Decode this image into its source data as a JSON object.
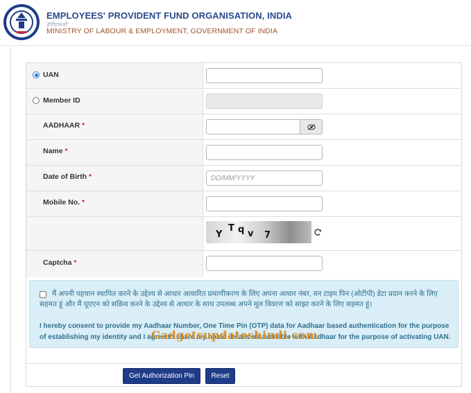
{
  "header": {
    "org_name": "EMPLOYEES' PROVIDENT FUND ORGANISATION, INDIA",
    "org_subtitle": "ईपीएफओ",
    "ministry": "MINISTRY OF LABOUR & EMPLOYMENT, GOVERNMENT OF INDIA"
  },
  "form": {
    "uan": {
      "label": "UAN",
      "selected": true,
      "value": ""
    },
    "member_id": {
      "label": "Member ID",
      "selected": false,
      "value": ""
    },
    "aadhaar": {
      "label": "AADHAAR",
      "required_mark": "*",
      "value": ""
    },
    "name": {
      "label": "Name",
      "required_mark": "*",
      "value": ""
    },
    "dob": {
      "label": "Date of Birth",
      "required_mark": "*",
      "placeholder": "DD/MM/YYYY",
      "value": ""
    },
    "mobile": {
      "label": "Mobile No.",
      "required_mark": "*",
      "value": ""
    },
    "captcha_image": {
      "characters": [
        "Y",
        "T",
        "q",
        "v",
        "7"
      ]
    },
    "captcha": {
      "label": "Captcha",
      "required_mark": "*",
      "value": ""
    }
  },
  "consent": {
    "checked": false,
    "hindi_text": "मैं अपनी पहचान स्थापित करने के उद्देश्य से आधार आधारित प्रमाणीकरण के लिए अपना आधार नंबर, वन टाइम पिन (ओटीपी) डेटा प्रदान करने के लिए सहमत हूं और मैं यूएएन को सक्रिय करने के उद्देश्य से आधार के साथ उपलब्ध अपने मूल विवरण को साझा करने के लिए सहमत हूं।",
    "english_text": "I hereby consent to provide my Aadhaar Number, One Time Pin (OTP) data for Aadhaar based authentication for the purpose of establishing my identity and I agree to share my basic details as available with Aadhaar for the purpose of activating UAN."
  },
  "watermark": "Gadgetsupdateshindi.com",
  "buttons": {
    "get_pin": "Get Authorization Pin",
    "reset": "Reset"
  },
  "colors": {
    "brand_blue": "#2a4a8c",
    "ministry_brown": "#a0522d",
    "button_navy": "#1f3c88",
    "required_red": "#d9232e",
    "consent_bg": "#d9eef7",
    "consent_text": "#31708f",
    "watermark": "#d98b1f"
  }
}
